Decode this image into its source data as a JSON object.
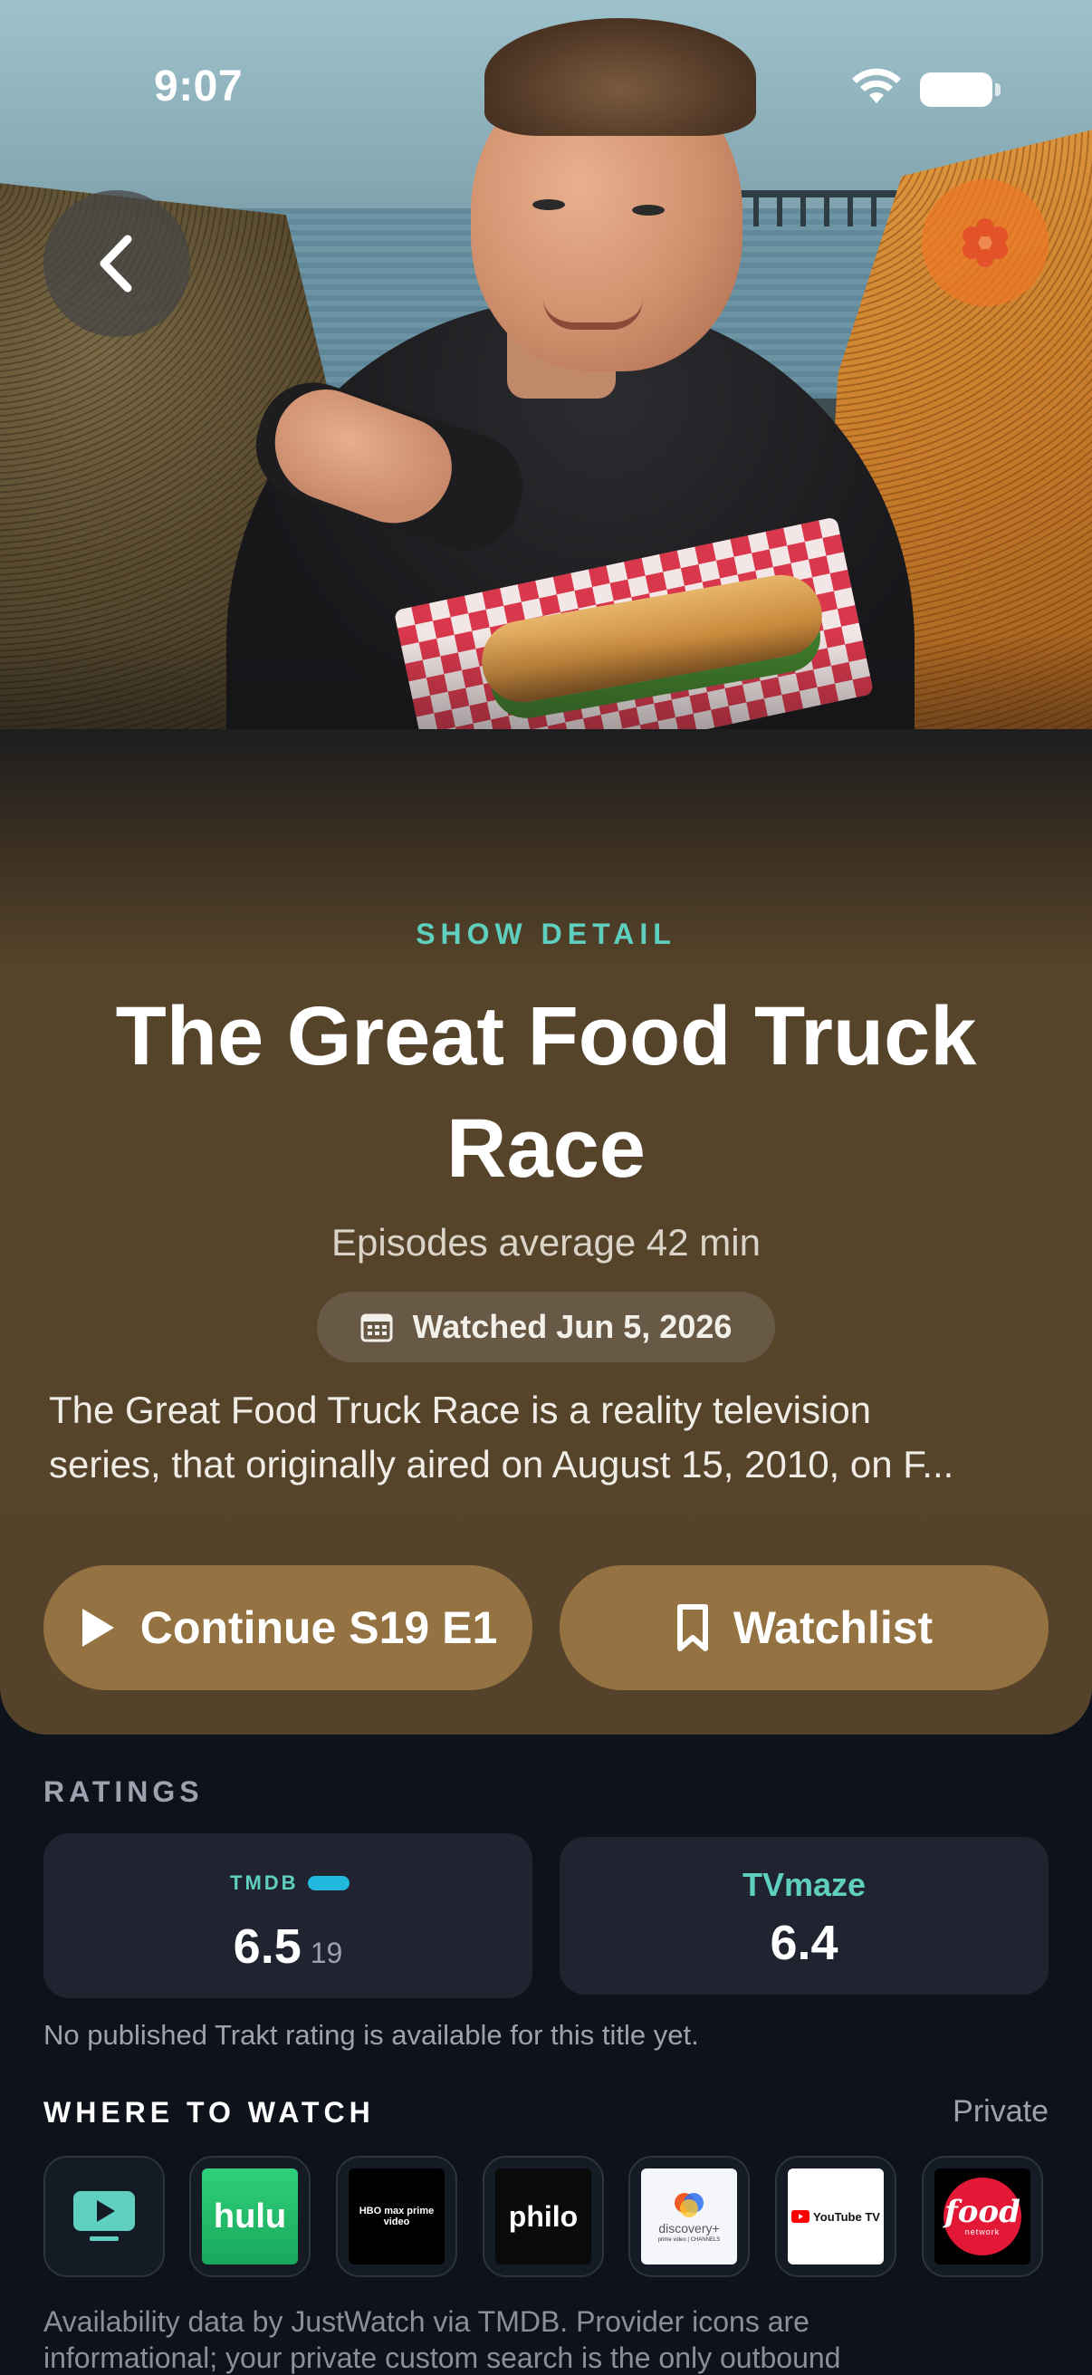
{
  "status_bar": {
    "time": "9:07"
  },
  "hero": {
    "back_icon": "chevron-left-icon",
    "settings_icon": "flower-icon",
    "accent": "#ec7828"
  },
  "show": {
    "eyebrow": "SHOW DETAIL",
    "title": "The Great Food Truck Race",
    "subtitle": "Episodes average 42 min",
    "watched": "Watched Jun 5, 2026",
    "description_line1": "The Great Food Truck Race is a reality television",
    "description_line2": "series, that originally aired on August 15, 2010, on F..."
  },
  "actions": {
    "continue_label": "Continue S19 E1",
    "watchlist_label": "Watchlist",
    "button_color": "#957241"
  },
  "ratings": {
    "label": "RATINGS",
    "tmdb": {
      "logo": "TMDB",
      "value": "6.5",
      "count": "19"
    },
    "tvmaze": {
      "name": "TVmaze",
      "value": "6.4"
    },
    "note": "No published Trakt rating is available for this title yet."
  },
  "where_to_watch": {
    "label": "WHERE TO WATCH",
    "privacy": "Private",
    "providers": [
      {
        "name": "Live TV",
        "icon": "tv-play-icon"
      },
      {
        "name": "hulu"
      },
      {
        "name": "HBO max prime video"
      },
      {
        "name": "philo"
      },
      {
        "name": "discovery+",
        "sub": "prime video | CHANNELS"
      },
      {
        "name": "YouTube TV"
      },
      {
        "name": "food",
        "sub": "network"
      }
    ],
    "footer_line1": "Availability data by JustWatch via TMDB. Provider icons are",
    "footer_line2": "informational; your private custom search is the only outbound"
  }
}
